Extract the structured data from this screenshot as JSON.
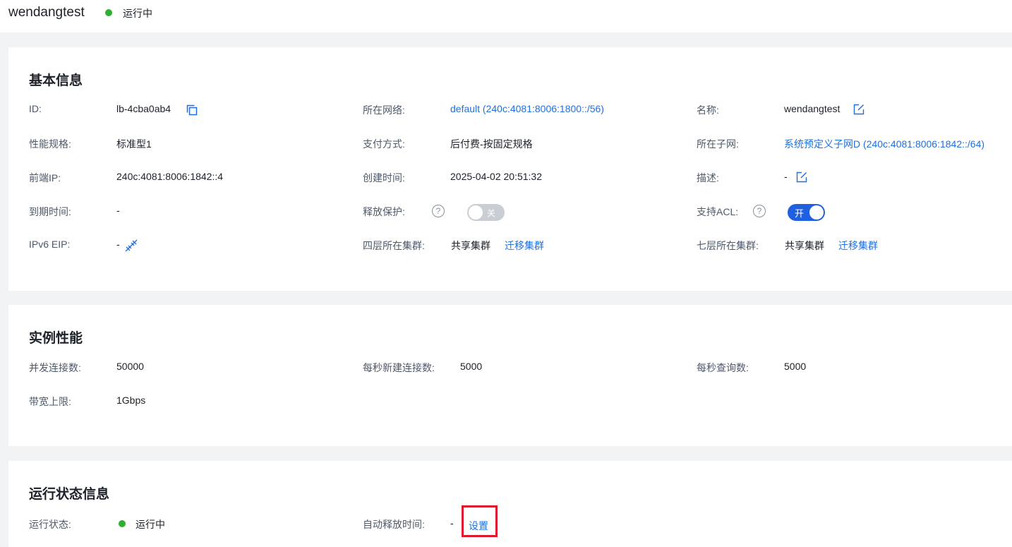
{
  "header": {
    "title": "wendangtest",
    "status": "运行中",
    "status_color": "#2bb02f"
  },
  "basic": {
    "title": "基本信息",
    "id_label": "ID:",
    "id_value": "lb-4cba0ab4",
    "network_label": "所在网络:",
    "network_value": "default (240c:4081:8006:1800::/56)",
    "name_label": "名称:",
    "name_value": "wendangtest",
    "spec_label": "性能规格:",
    "spec_value": "标准型1",
    "pay_label": "支付方式:",
    "pay_value": "后付费-按固定规格",
    "subnet_label": "所在子网:",
    "subnet_value": "系统预定义子网D (240c:4081:8006:1842::/64)",
    "frontend_ip_label": "前端IP:",
    "frontend_ip_value": "240c:4081:8006:1842::4",
    "created_label": "创建时间:",
    "created_value": "2025-04-02 20:51:32",
    "desc_label": "描述:",
    "desc_value": "-",
    "expire_label": "到期时间:",
    "expire_value": "-",
    "release_protect_label": "释放保护:",
    "release_protect_toggle": "关",
    "acl_label": "支持ACL:",
    "acl_toggle": "开",
    "eip_label": "IPv6 EIP:",
    "eip_value": "-",
    "l4_cluster_label": "四层所在集群:",
    "l4_cluster_value": "共享集群",
    "l4_migrate": "迁移集群",
    "l7_cluster_label": "七层所在集群:",
    "l7_cluster_value": "共享集群",
    "l7_migrate": "迁移集群"
  },
  "perf": {
    "title": "实例性能",
    "concurrent_label": "并发连接数:",
    "concurrent_value": "50000",
    "new_conn_label": "每秒新建连接数:",
    "new_conn_value": "5000",
    "qps_label": "每秒查询数:",
    "qps_value": "5000",
    "bandwidth_label": "带宽上限:",
    "bandwidth_value": "1Gbps"
  },
  "runtime": {
    "title": "运行状态信息",
    "status_label": "运行状态:",
    "status_value": "运行中",
    "auto_release_label": "自动释放时间:",
    "auto_release_value": "-",
    "set_link": "设置"
  },
  "colors": {
    "link": "#1f6fdc",
    "toggle_on": "#2060e0",
    "toggle_off": "#c9cdd4",
    "highlight": "#e0162b"
  }
}
